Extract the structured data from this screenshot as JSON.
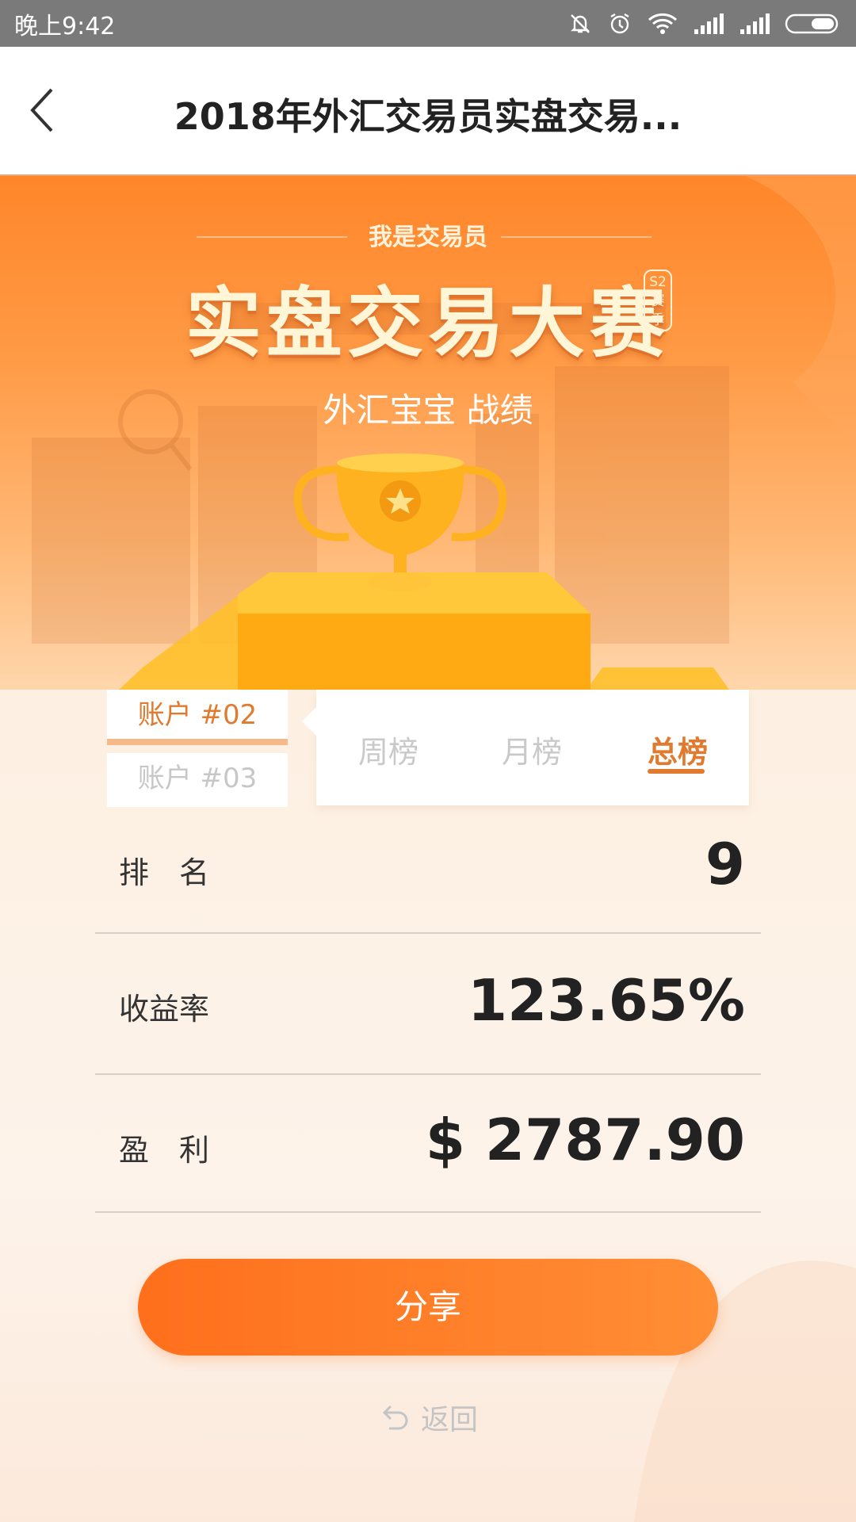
{
  "status_bar": {
    "time": "晚上9:42",
    "icons": [
      "bell-off-icon",
      "alarm-icon",
      "wifi-icon",
      "signal-icon",
      "signal-icon",
      "battery-icon"
    ]
  },
  "nav": {
    "back_icon": "chevron-left-icon",
    "title": "2018年外汇交易员实盘交易..."
  },
  "banner": {
    "brand": "我是交易员",
    "contest_title": "实盘交易大赛",
    "season_badge": "S2赛季",
    "subtitle": "外汇宝宝 战绩",
    "colors": {
      "top": "#ff862a",
      "bottom": "#ffd6ab",
      "trophy": "#ffb21f"
    }
  },
  "accounts": {
    "active": "账户 #02",
    "inactive": "账户 #03"
  },
  "period_tabs": {
    "items": [
      "周榜",
      "月榜",
      "总榜"
    ],
    "selected": "总榜",
    "accent": "#e07a2e"
  },
  "stats": {
    "rank_label": "排　名",
    "rank_value": "9",
    "yield_label": "收益率",
    "yield_value": "123.65%",
    "profit_label": "盈　利",
    "profit_value": "$ 2787.90"
  },
  "actions": {
    "share": "分享",
    "return": "返回",
    "return_icon": "undo-arrow-icon"
  }
}
